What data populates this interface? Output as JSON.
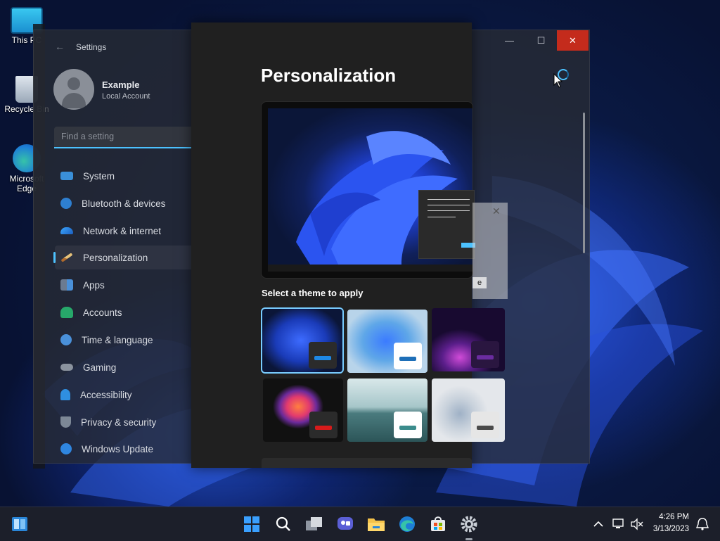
{
  "desktop": {
    "icons": [
      {
        "label": "This PC"
      },
      {
        "label": "Recycle Bin"
      },
      {
        "label": "Microsoft Edge"
      }
    ]
  },
  "settings": {
    "title": "Settings",
    "user": {
      "name": "Example",
      "account_type": "Local Account"
    },
    "search": {
      "placeholder": "Find a setting"
    },
    "nav": [
      {
        "label": "System",
        "icon": "system-icon"
      },
      {
        "label": "Bluetooth & devices",
        "icon": "bluetooth-icon"
      },
      {
        "label": "Network & internet",
        "icon": "network-icon"
      },
      {
        "label": "Personalization",
        "icon": "brush-icon",
        "selected": true
      },
      {
        "label": "Apps",
        "icon": "apps-icon"
      },
      {
        "label": "Accounts",
        "icon": "accounts-icon"
      },
      {
        "label": "Time & language",
        "icon": "clock-icon"
      },
      {
        "label": "Gaming",
        "icon": "gamepad-icon"
      },
      {
        "label": "Accessibility",
        "icon": "accessibility-icon"
      },
      {
        "label": "Privacy & security",
        "icon": "shield-icon"
      },
      {
        "label": "Windows Update",
        "icon": "update-icon"
      }
    ],
    "window_buttons": {
      "minimize": "—",
      "maximize": "☐",
      "close": "✕"
    }
  },
  "personalization": {
    "title": "Personalization",
    "theme_section_label": "Select a theme to apply",
    "ghost_button_text": "e",
    "themes": [
      {
        "name": "windows-dark",
        "tag_bg": "#2b2b2b",
        "pill": "#1e88e5",
        "selected": true
      },
      {
        "name": "windows-light",
        "tag_bg": "#ffffff",
        "pill": "#1e6fb8"
      },
      {
        "name": "glow",
        "tag_bg": "#2a1640",
        "pill": "#6a2ca0"
      },
      {
        "name": "captured-motion",
        "tag_bg": "#2b2b2b",
        "pill": "#d81b1b"
      },
      {
        "name": "sunrise",
        "tag_bg": "#ffffff",
        "pill": "#3b8c8c"
      },
      {
        "name": "flow",
        "tag_bg": "#e6e6e6",
        "pill": "#4a4a4a"
      }
    ]
  },
  "taskbar": {
    "time": "4:26 PM",
    "date": "3/13/2023",
    "icons": [
      "widgets-icon",
      "start-icon",
      "search-icon",
      "task-view-icon",
      "chat-icon",
      "file-explorer-icon",
      "edge-icon",
      "store-icon",
      "settings-icon"
    ]
  },
  "colors": {
    "accent": "#4cc2ff",
    "close_red": "#c42b1c"
  }
}
